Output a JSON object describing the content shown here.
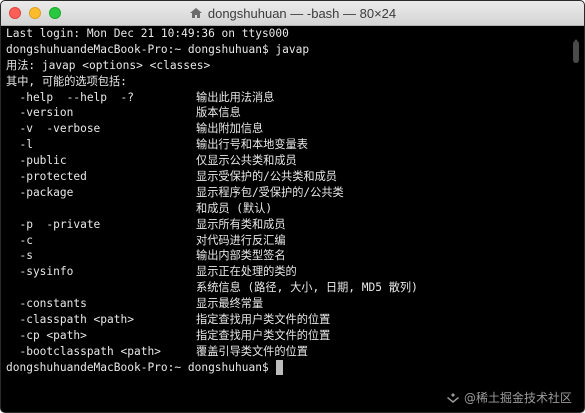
{
  "window": {
    "title": "dongshuhuan — -bash — 80×24"
  },
  "terminal": {
    "header_lines": [
      "Last login: Mon Dec 21 10:49:36 on ttys000",
      "dongshuhuandeMacBook-Pro:~ dongshuhuan$ javap",
      "用法: javap <options> <classes>",
      "其中, 可能的选项包括:"
    ],
    "options": [
      {
        "flag": "  -help  --help  -?",
        "desc": "输出此用法消息"
      },
      {
        "flag": "  -version",
        "desc": "版本信息"
      },
      {
        "flag": "  -v  -verbose",
        "desc": "输出附加信息"
      },
      {
        "flag": "  -l",
        "desc": "输出行号和本地变量表"
      },
      {
        "flag": "  -public",
        "desc": "仅显示公共类和成员"
      },
      {
        "flag": "  -protected",
        "desc": "显示受保护的/公共类和成员"
      },
      {
        "flag": "  -package",
        "desc": "显示程序包/受保护的/公共类"
      },
      {
        "flag": "",
        "desc": "和成员 (默认)"
      },
      {
        "flag": "  -p  -private",
        "desc": "显示所有类和成员"
      },
      {
        "flag": "  -c",
        "desc": "对代码进行反汇编"
      },
      {
        "flag": "  -s",
        "desc": "输出内部类型签名"
      },
      {
        "flag": "  -sysinfo",
        "desc": "显示正在处理的类的"
      },
      {
        "flag": "",
        "desc": "系统信息 (路径, 大小, 日期, MD5 散列)"
      },
      {
        "flag": "  -constants",
        "desc": "显示最终常量"
      },
      {
        "flag": "  -classpath <path>",
        "desc": "指定查找用户类文件的位置"
      },
      {
        "flag": "  -cp <path>",
        "desc": "指定查找用户类文件的位置"
      },
      {
        "flag": "  -bootclasspath <path>",
        "desc": "覆盖引导类文件的位置"
      }
    ],
    "prompt": "dongshuhuandeMacBook-Pro:~ dongshuhuan$"
  },
  "watermark": {
    "text": "@稀土掘金技术社区"
  },
  "colors": {
    "background": "#000000",
    "foreground": "#e8e8e8",
    "titlebar": "#dcdcdc",
    "close": "#fc5f57",
    "minimize": "#fdbc2e",
    "maximize": "#28c840"
  },
  "icons": {
    "title": "home-icon",
    "watermark": "juejin-logo-icon"
  }
}
